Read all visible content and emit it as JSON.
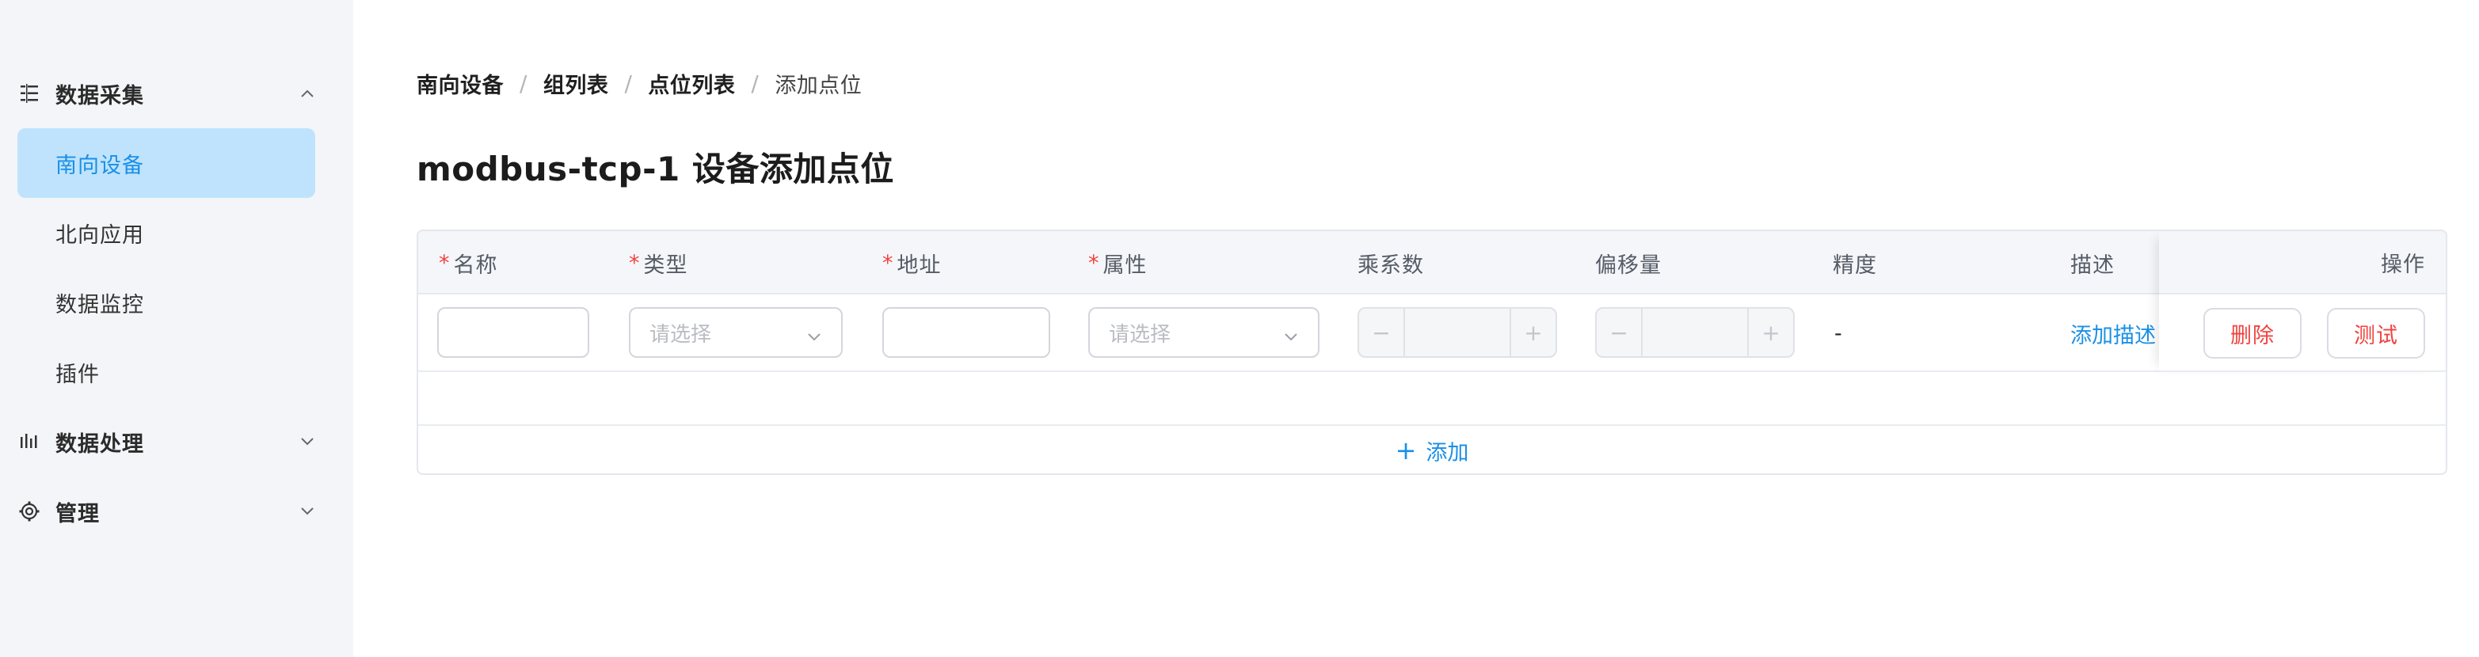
{
  "sidebar": {
    "groups": [
      {
        "label": "数据采集",
        "icon": "list-icon",
        "expanded": true
      },
      {
        "label": "数据处理",
        "icon": "bars-icon",
        "expanded": false
      },
      {
        "label": "管理",
        "icon": "gear-icon",
        "expanded": false
      }
    ],
    "items": [
      {
        "label": "南向设备",
        "active": true
      },
      {
        "label": "北向应用",
        "active": false
      },
      {
        "label": "数据监控",
        "active": false
      },
      {
        "label": "插件",
        "active": false
      }
    ]
  },
  "breadcrumb": [
    "南向设备",
    "组列表",
    "点位列表",
    "添加点位"
  ],
  "page_title": "modbus-tcp-1 设备添加点位",
  "table": {
    "columns": [
      {
        "label": "名称",
        "required": true
      },
      {
        "label": "类型",
        "required": true
      },
      {
        "label": "地址",
        "required": true
      },
      {
        "label": "属性",
        "required": true
      },
      {
        "label": "乘系数",
        "required": false
      },
      {
        "label": "偏移量",
        "required": false
      },
      {
        "label": "精度",
        "required": false
      },
      {
        "label": "描述",
        "required": false
      },
      {
        "label": "操作",
        "required": false
      }
    ],
    "row": {
      "name_value": "",
      "type_placeholder": "请选择",
      "address_value": "",
      "attribute_placeholder": "请选择",
      "multiplier_value": "",
      "offset_value": "",
      "precision_value": "-",
      "description_link": "添加描述",
      "delete_label": "删除",
      "test_label": "测试"
    },
    "add_label": "添加"
  },
  "colors": {
    "accent": "#1a90e6",
    "active_bg": "#bfe3fd",
    "danger": "#f0433f",
    "sidebar_bg": "#f4f5f9",
    "header_bg": "#f5f6fa"
  }
}
